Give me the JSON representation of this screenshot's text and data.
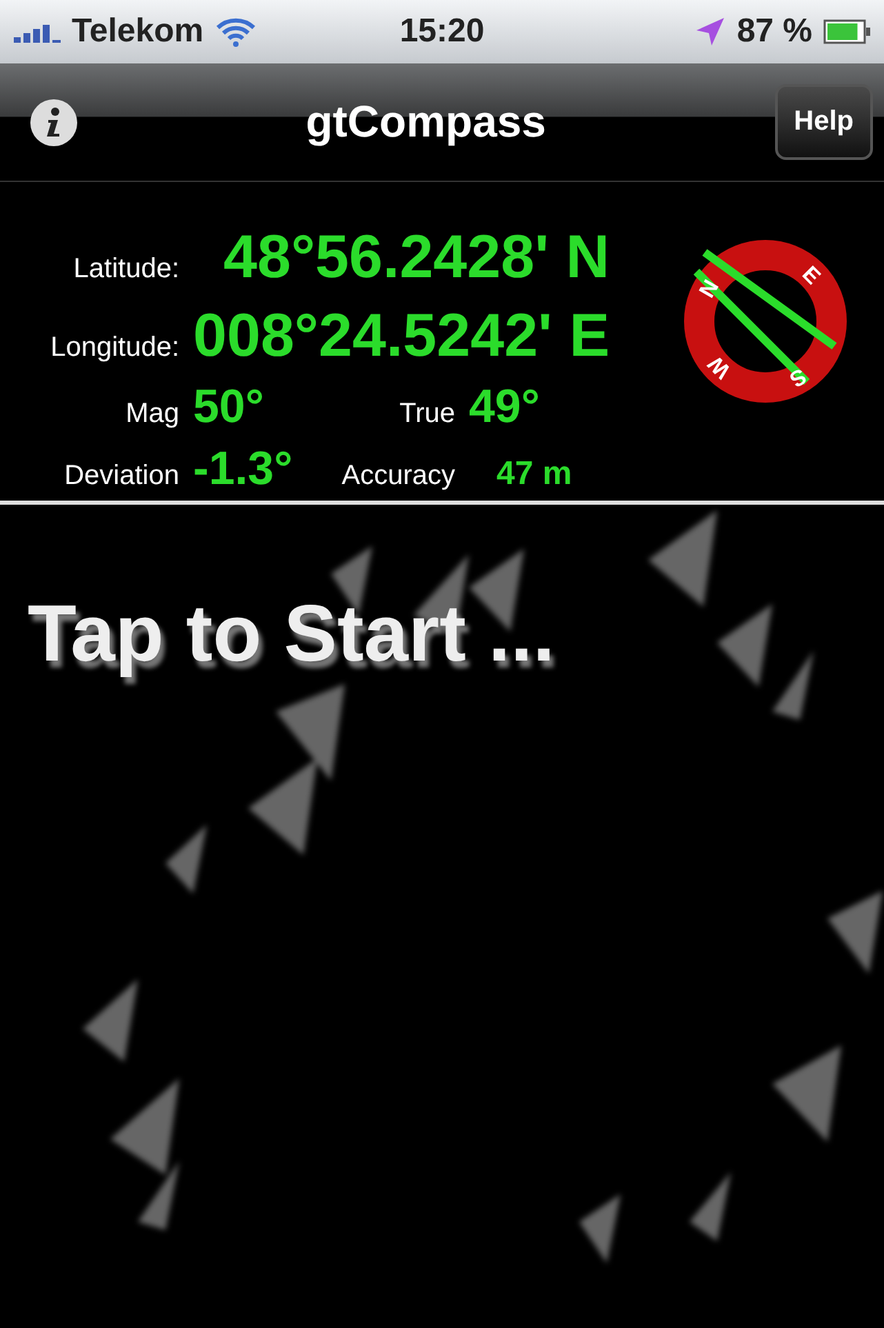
{
  "status_bar": {
    "carrier": "Telekom",
    "time": "15:20",
    "battery": "87 %"
  },
  "nav_bar": {
    "title": "gtCompass",
    "right_button": "Help"
  },
  "readings": {
    "latitude_label": "Latitude:",
    "latitude": "48°56.2428' N",
    "longitude_label": "Longitude:",
    "longitude": "008°24.5242' E",
    "mag_label": "Mag",
    "mag": "50°",
    "true_label": "True",
    "true": "49°",
    "deviation_label": "Deviation",
    "deviation": "-1.3°",
    "accuracy_label": "Accuracy",
    "accuracy": "47 m"
  },
  "compass": {
    "letters": [
      "N",
      "E",
      "S",
      "W"
    ]
  },
  "main": {
    "prompt": "Tap to Start ..."
  }
}
